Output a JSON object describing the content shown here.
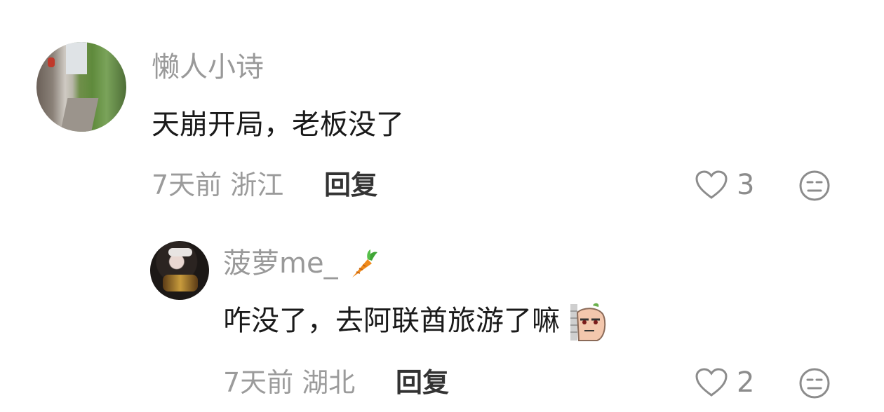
{
  "comments": [
    {
      "username": "懒人小诗",
      "text": "天崩开局，老板没了",
      "time": "7天前",
      "location": "浙江",
      "reply_label": "回复",
      "like_count": "3",
      "icons": {
        "like": "heart-icon",
        "emoji": "emoji-reaction-icon"
      }
    },
    {
      "username": "菠萝me_",
      "username_emoji": "carrot-emoji",
      "text": "咋没了，去阿联酋旅游了嘛",
      "text_sticker": "peeking-sticker",
      "time": "7天前",
      "location": "湖北",
      "reply_label": "回复",
      "like_count": "2",
      "icons": {
        "like": "heart-icon",
        "emoji": "emoji-reaction-icon"
      }
    }
  ]
}
